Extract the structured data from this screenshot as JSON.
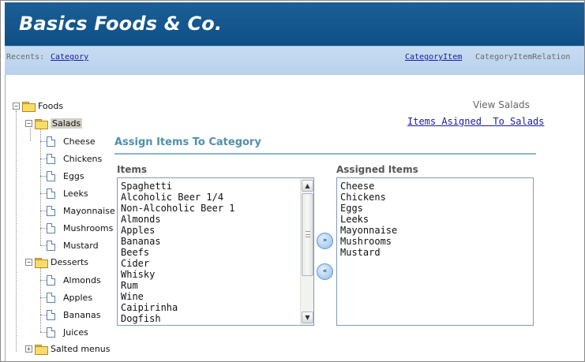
{
  "header": {
    "app_title": "Basics Foods & Co."
  },
  "recents": {
    "label": "Recents:",
    "left_link": "Category",
    "right_link": "CategoryItem",
    "current": "CategoryItemRelation"
  },
  "tree": {
    "root": {
      "label": "Foods",
      "expanded": true
    },
    "salads": {
      "label": "Salads",
      "expanded": true,
      "selected": true,
      "items": [
        "Cheese",
        "Chickens",
        "Eggs",
        "Leeks",
        "Mayonnaise",
        "Mushrooms",
        "Mustard"
      ]
    },
    "desserts": {
      "label": "Desserts",
      "expanded": true,
      "items": [
        "Almonds",
        "Apples",
        "Bananas",
        "Juices"
      ]
    },
    "salted": {
      "label": "Salted menus",
      "expanded": false
    }
  },
  "main": {
    "view_title": "View Salads",
    "assigned_link": "Items Asigned  To Salads",
    "section_title": "Assign Items To Category",
    "items_caption": "Items",
    "assigned_caption": "Assigned Items",
    "items": [
      "Spaghetti",
      "Alcoholic Beer 1/4",
      "Non-Alcoholic Beer 1",
      "Almonds",
      "Apples",
      "Bananas",
      "Beefs",
      "Cider",
      "Whisky",
      "Rum",
      "Wine",
      "Caipirinha",
      "Dogfish"
    ],
    "assigned_items": [
      "Cheese",
      "Chickens",
      "Eggs",
      "Leeks",
      "Mayonnaise",
      "Mushrooms",
      "Mustard"
    ]
  },
  "icons": {
    "toggle_expanded": "minus-box-icon",
    "toggle_collapsed": "plus-box-icon",
    "folder": "folder-icon",
    "document": "document-icon",
    "move_right": "double-chevron-right-icon",
    "move_left": "double-chevron-left-icon"
  },
  "colors": {
    "header": "#0e4f86",
    "recents_bar": "#c7dcf2",
    "section_title": "#4f8fae",
    "link": "#1a1aa6"
  }
}
